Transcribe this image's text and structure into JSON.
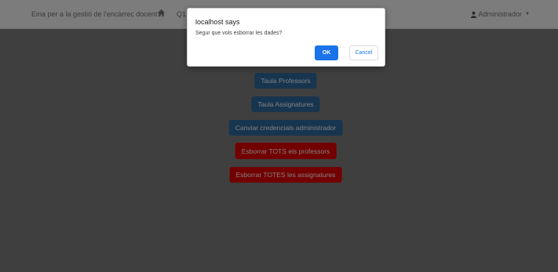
{
  "navbar": {
    "brand": "Eina per a la gestió de l'encàrrec docent",
    "home_icon": "home-icon",
    "menu_item": "Q1",
    "user": "Administrador",
    "user_icon": "user-icon"
  },
  "main": {
    "buttons": [
      "Taula Professors",
      "Taula Assignatures",
      "Canviar credencials administrador",
      "Esborrar TOTS els professors",
      "Esborrar TOTES les assignatures"
    ]
  },
  "dialog": {
    "title": "localhost says",
    "message": "Segur que vols esborrar les dades?",
    "ok": "OK",
    "cancel": "Cancel"
  },
  "colors": {
    "primary_button": "#2f6a9e",
    "danger_button": "#e60000",
    "dialog_ok": "#1a73e8"
  }
}
